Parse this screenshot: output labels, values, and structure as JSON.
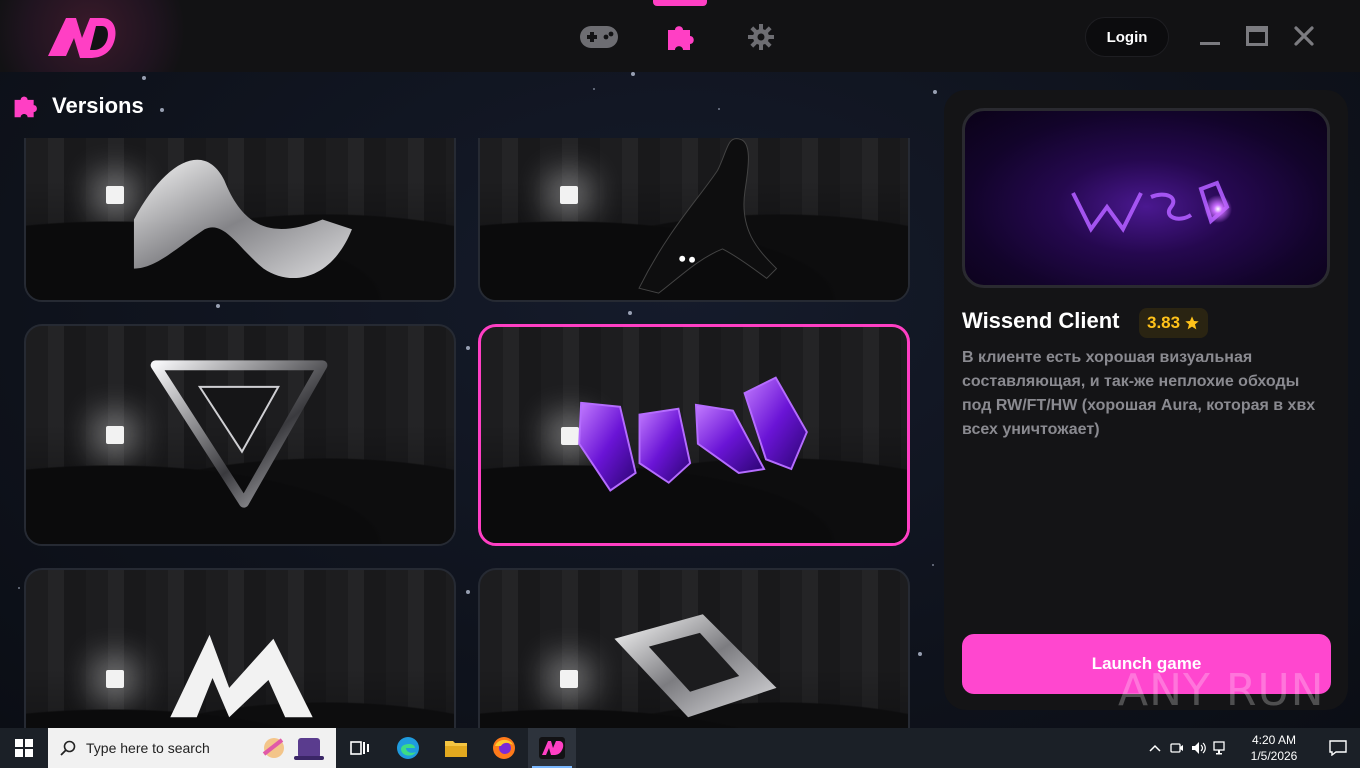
{
  "header": {
    "nav": [
      {
        "name": "gamepad-icon"
      },
      {
        "name": "puzzle-icon",
        "active": true
      },
      {
        "name": "gear-icon"
      }
    ],
    "login_label": "Login",
    "accent": "#ff3fc4"
  },
  "versions": {
    "title": "Versions",
    "cards": [
      {
        "art": "silver-wave-logo"
      },
      {
        "art": "black-cat"
      },
      {
        "art": "silver-v-logo"
      },
      {
        "art": "purple-crystals-logo",
        "selected": true
      },
      {
        "art": "white-m-logo"
      },
      {
        "art": "silver-s-logo"
      }
    ]
  },
  "details": {
    "name": "Wissend Client",
    "rating": "3.83",
    "rating_color": "#ffc21a",
    "description": "В клиенте есть хорошая визуальная составляющая, и так-же неплохие обходы под RW/FT/HW (хорошая Aura, которая в хвх всех уничтожает)",
    "launch_label": "Launch game",
    "launch_color": "#ff47cf"
  },
  "watermark": "ANY RUN",
  "taskbar": {
    "search_placeholder": "Type here to search",
    "time": "4:20 AM",
    "date": "1/5/2026"
  }
}
